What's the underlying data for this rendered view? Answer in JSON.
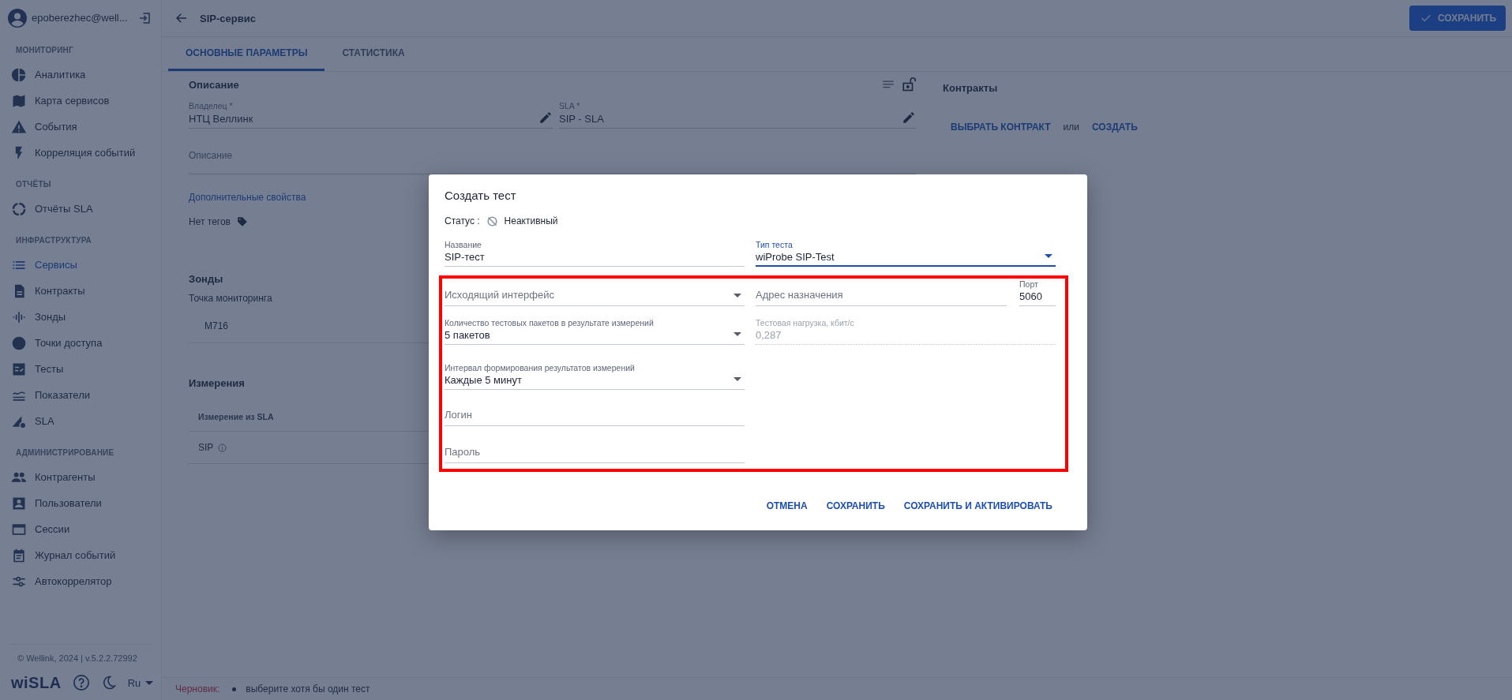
{
  "user": {
    "email": "epoberezhec@well..."
  },
  "sidebar": {
    "sections": [
      {
        "title": "МОНИТОРИНГ",
        "items": [
          {
            "label": "Аналитика",
            "selected": false
          },
          {
            "label": "Карта сервисов",
            "selected": false
          },
          {
            "label": "События",
            "selected": false
          },
          {
            "label": "Корреляция событий",
            "selected": false
          }
        ]
      },
      {
        "title": "ОТЧЁТЫ",
        "items": [
          {
            "label": "Отчёты SLA",
            "selected": false
          }
        ]
      },
      {
        "title": "ИНФРАСТРУКТУРА",
        "items": [
          {
            "label": "Сервисы",
            "selected": true
          },
          {
            "label": "Контракты",
            "selected": false
          },
          {
            "label": "Зонды",
            "selected": false
          },
          {
            "label": "Точки доступа",
            "selected": false
          },
          {
            "label": "Тесты",
            "selected": false
          },
          {
            "label": "Показатели",
            "selected": false
          },
          {
            "label": "SLA",
            "selected": false
          }
        ]
      },
      {
        "title": "АДМИНИСТРИРОВАНИЕ",
        "items": [
          {
            "label": "Контрагенты",
            "selected": false
          },
          {
            "label": "Пользователи",
            "selected": false
          },
          {
            "label": "Сессии",
            "selected": false
          },
          {
            "label": "Журнал событий",
            "selected": false
          },
          {
            "label": "Автокоррелятор",
            "selected": false
          }
        ]
      }
    ]
  },
  "footer": {
    "copyright": "© Wellink, 2024 | v.5.2.2.72992",
    "logo": "wiSLA",
    "language": "Ru"
  },
  "header": {
    "title": "SIP-сервис",
    "save_button": "СОХРАНИТЬ"
  },
  "tabs": [
    {
      "label": "ОСНОВНЫЕ ПАРАМЕТРЫ",
      "selected": true
    },
    {
      "label": "СТАТИСТИКА",
      "selected": false
    }
  ],
  "description": {
    "heading": "Описание",
    "owner": {
      "label": "Владелец *",
      "value": "НТЦ Веллинк"
    },
    "sla": {
      "label": "SLA *",
      "value": "SIP - SLA"
    },
    "description_placeholder": "Описание",
    "more_link": "Дополнительные свойства",
    "tags": "Нет тегов"
  },
  "probes": {
    "heading": "Зонды",
    "label": "Точка мониторинга",
    "items": [
      "M716"
    ]
  },
  "measurements": {
    "heading": "Измерения",
    "column": "Измерение из SLA",
    "rows": [
      "SIP"
    ]
  },
  "contracts": {
    "heading": "Контракты",
    "select_link": "ВЫБРАТЬ КОНТРАКТ",
    "separator": "или",
    "create_link": "СОЗДАТЬ"
  },
  "status_bar": {
    "label": "Черновик:",
    "messages": [
      "выберите хотя бы один тест"
    ]
  },
  "dialog": {
    "title": "Создать тест",
    "status_label": "Статус :",
    "status": "Неактивный",
    "active": false,
    "rows": [
      {
        "fields": [
          {
            "kind": "text",
            "label": "Название",
            "value": "SIP-тест",
            "focused": false,
            "disabled": false
          },
          {
            "kind": "select",
            "label": "Тип теста",
            "value": "wiProbe SIP-Test",
            "focused": true,
            "disabled": false
          }
        ]
      },
      {
        "fields": [
          {
            "kind": "select",
            "placeholder": "Исходящий интерфейс",
            "focused": false,
            "disabled": false
          },
          {
            "kind": "text",
            "placeholder": "Адрес назначения",
            "focused": false,
            "disabled": false
          },
          {
            "kind": "text",
            "label": "Порт",
            "value": "5060",
            "focused": false,
            "disabled": false
          }
        ]
      },
      {
        "fields": [
          {
            "kind": "select",
            "label": "Количество тестовых пакетов в результате измерений",
            "value": "5 пакетов",
            "focused": false,
            "disabled": false
          },
          {
            "kind": "text",
            "label": "Тестовая нагрузка, кбит/с",
            "value": "0,287",
            "focused": false,
            "disabled": true
          }
        ]
      },
      {
        "fields": [
          {
            "kind": "select",
            "label": "Интервал формирования результатов измерений",
            "value": "Каждые 5 минут",
            "focused": false,
            "disabled": false
          }
        ]
      },
      {
        "fields": [
          {
            "kind": "text",
            "placeholder": "Логин",
            "focused": false,
            "disabled": false
          }
        ]
      },
      {
        "fields": [
          {
            "kind": "text",
            "placeholder": "Пароль",
            "focused": false,
            "disabled": false
          }
        ]
      }
    ],
    "buttons": [
      "ОТМЕНА",
      "СОХРАНИТЬ",
      "СОХРАНИТЬ И АКТИВИРОВАТЬ"
    ]
  }
}
